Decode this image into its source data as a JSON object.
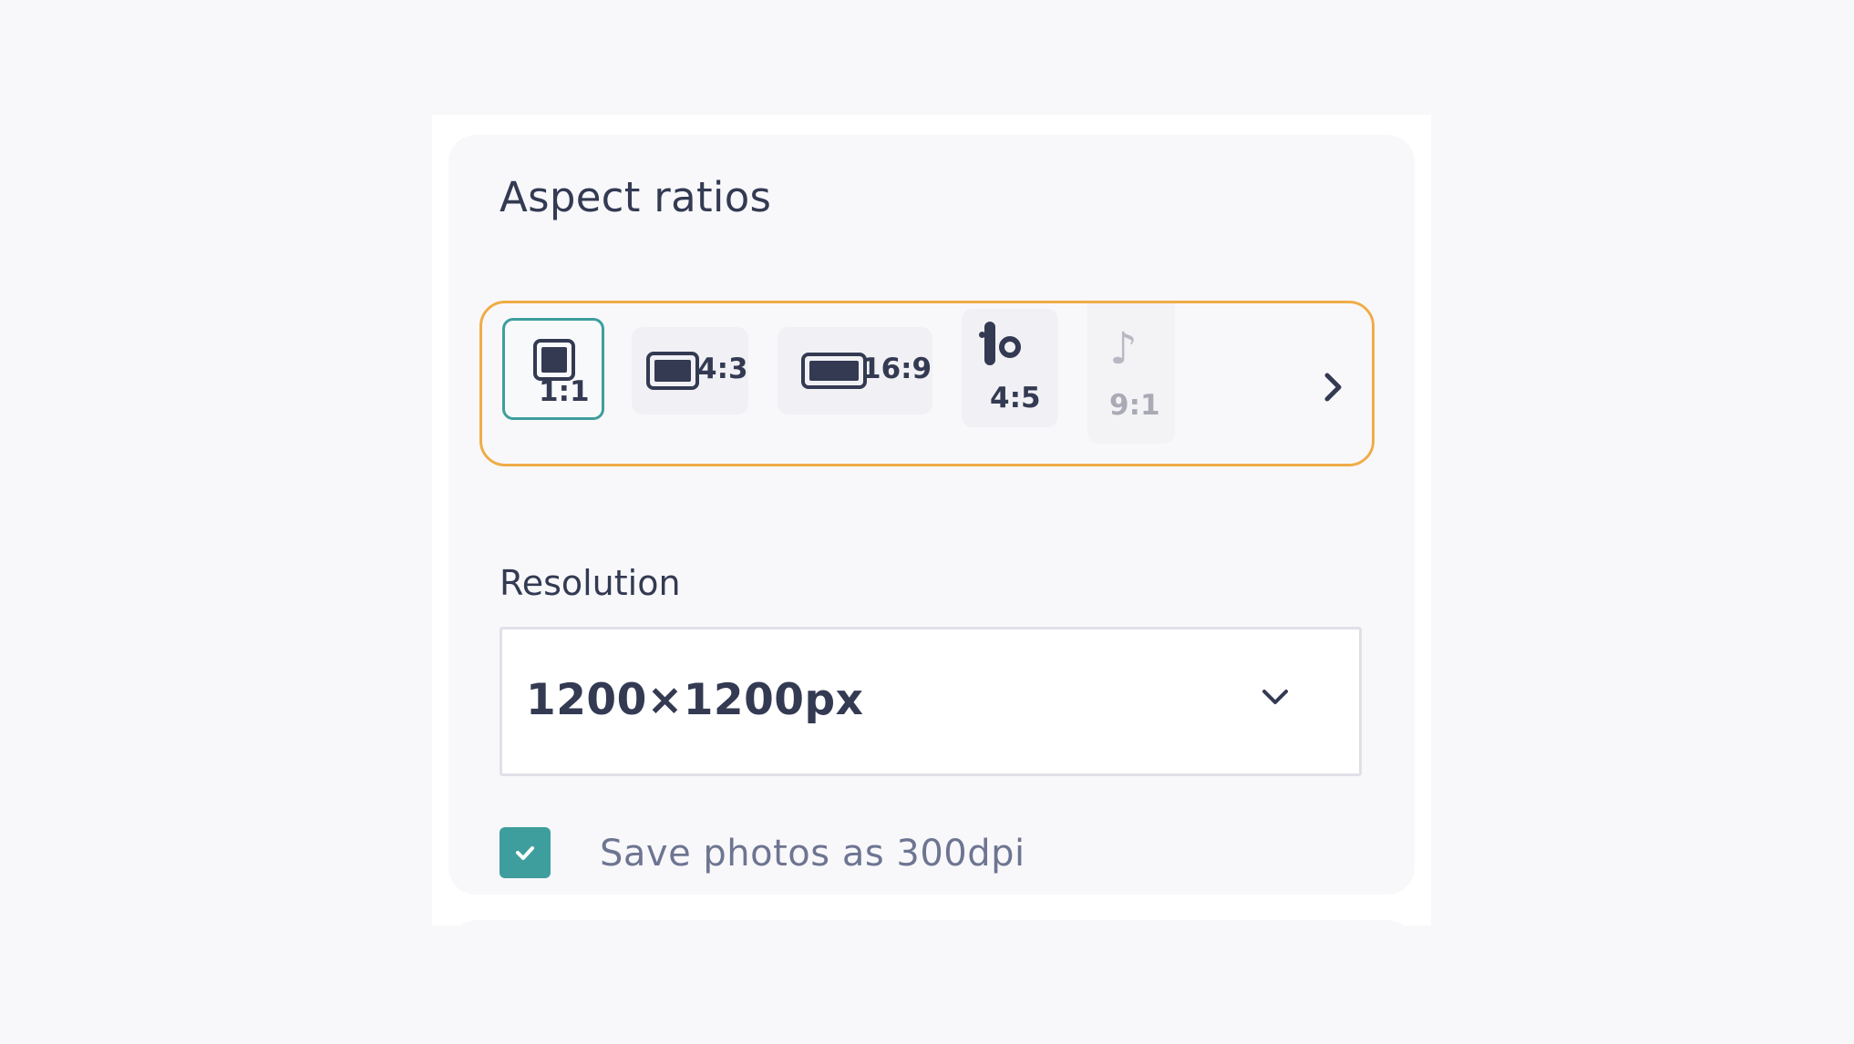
{
  "aspect_ratios": {
    "title": "Aspect ratios",
    "options": [
      {
        "label": "1:1",
        "icon": "square-frame-icon",
        "selected": true
      },
      {
        "label": "4:3",
        "icon": "landscape-4-3-frame-icon",
        "selected": false
      },
      {
        "label": "16:9",
        "icon": "widescreen-16-9-frame-icon",
        "selected": false
      },
      {
        "label": "4:5",
        "icon": "instagram-icon",
        "selected": false
      },
      {
        "label": "9:1",
        "icon": "tiktok-icon",
        "selected": false
      }
    ],
    "next_icon": "chevron-right-icon"
  },
  "resolution": {
    "label": "Resolution",
    "value": "1200×1200px",
    "dropdown_icon": "chevron-down-icon"
  },
  "dpi_option": {
    "label": "Save photos as 300dpi",
    "checked": true,
    "icon": "checkmark-icon"
  },
  "colors": {
    "highlight_border": "#f0ac47",
    "accent": "#3e9e9d",
    "text_primary": "#333a52",
    "text_secondary": "#6e7591"
  }
}
